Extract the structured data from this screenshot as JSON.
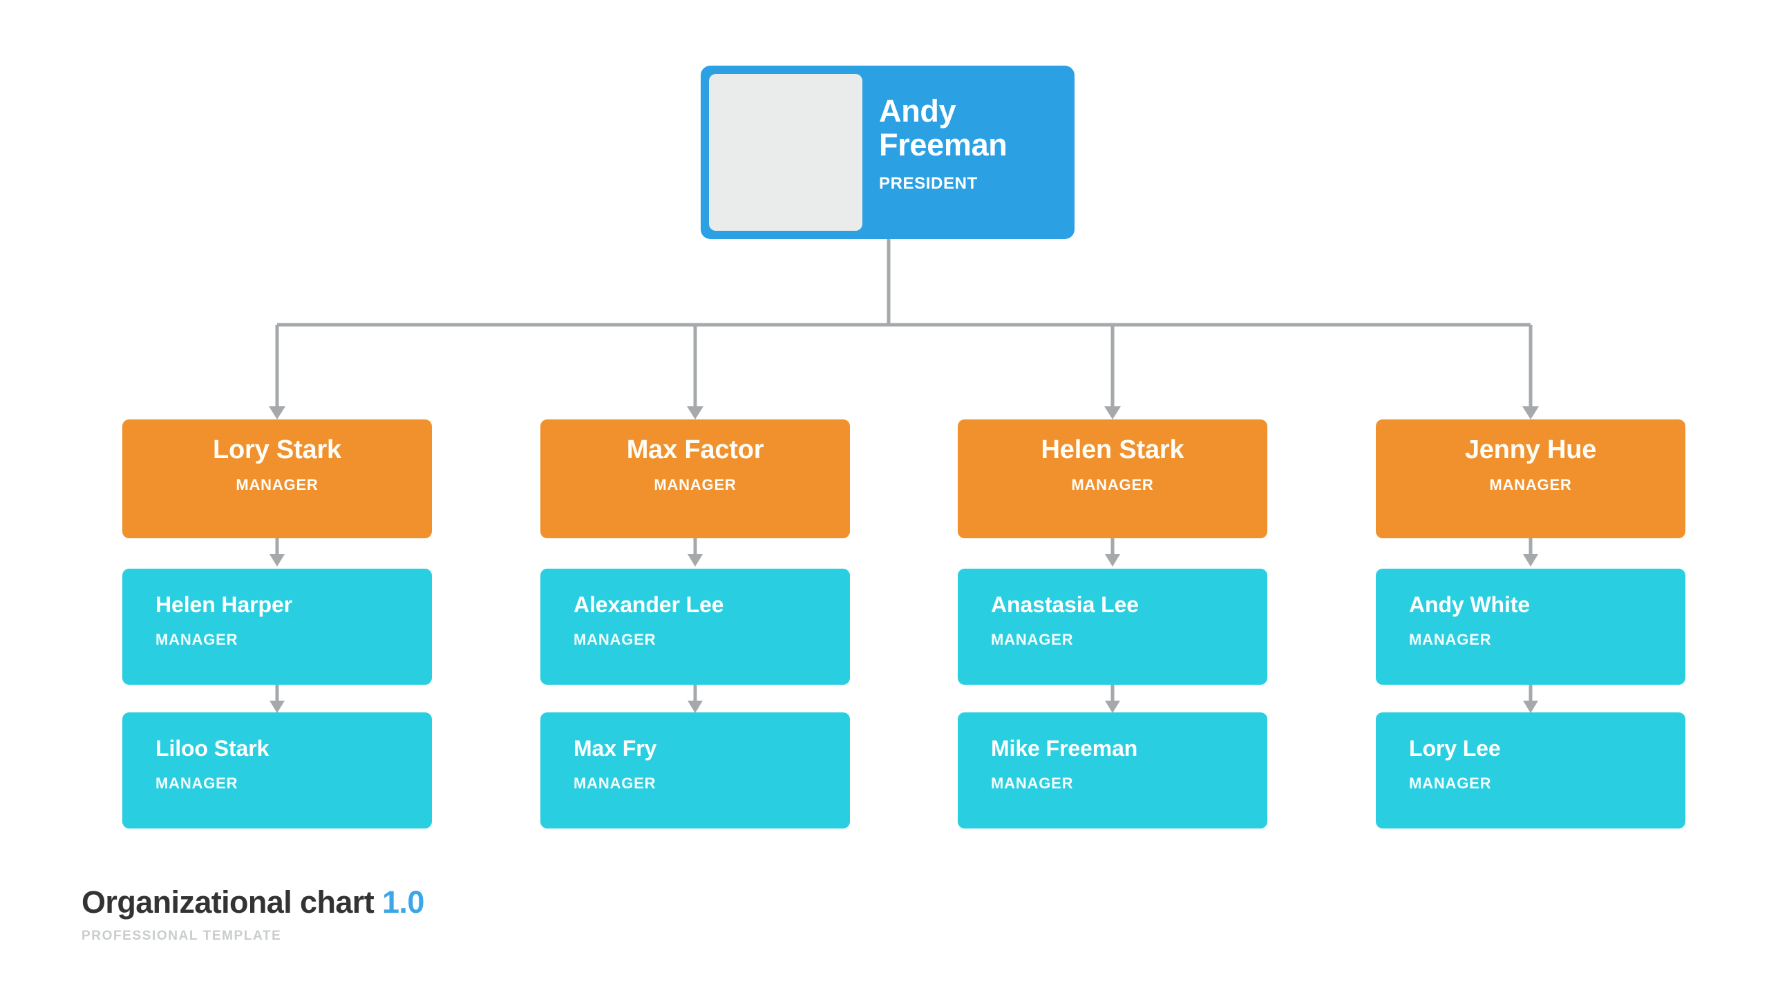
{
  "chart_data": {
    "type": "diagram",
    "title": "Organizational chart 1.0",
    "subtitle": "PROFESSIONAL TEMPLATE",
    "orientation": "top-down",
    "levels": 4,
    "colors": {
      "root": "#2BA0E3",
      "manager": "#F0912D",
      "staff": "#29CEE0",
      "connector": "#A6A9AB",
      "avatar": "#EAEBEB",
      "accent": "#3CA7E8",
      "title": "#333333",
      "subtitle": "#C9CCCE"
    }
  },
  "root": {
    "name": "Andy Freeman",
    "name_line1": "Andy",
    "name_line2": "Freeman",
    "role": "PRESIDENT",
    "avatar": "photo-placeholder"
  },
  "columns": [
    {
      "manager": {
        "name": "Lory Stark",
        "role": "MANAGER"
      },
      "staff": [
        {
          "name": "Helen Harper",
          "role": "MANAGER"
        },
        {
          "name": "Liloo Stark",
          "role": "MANAGER"
        }
      ]
    },
    {
      "manager": {
        "name": "Max Factor",
        "role": "MANAGER"
      },
      "staff": [
        {
          "name": "Alexander Lee",
          "role": "MANAGER"
        },
        {
          "name": "Max Fry",
          "role": "MANAGER"
        }
      ]
    },
    {
      "manager": {
        "name": "Helen Stark",
        "role": "MANAGER"
      },
      "staff": [
        {
          "name": "Anastasia Lee",
          "role": "MANAGER"
        },
        {
          "name": "Mike Freeman",
          "role": "MANAGER"
        }
      ]
    },
    {
      "manager": {
        "name": "Jenny Hue",
        "role": "MANAGER"
      },
      "staff": [
        {
          "name": "Andy White",
          "role": "MANAGER"
        },
        {
          "name": "Lory Lee",
          "role": "MANAGER"
        }
      ]
    }
  ],
  "footer": {
    "title_main": "Organizational chart",
    "title_version": "1.0",
    "subtitle": "PROFESSIONAL TEMPLATE"
  }
}
